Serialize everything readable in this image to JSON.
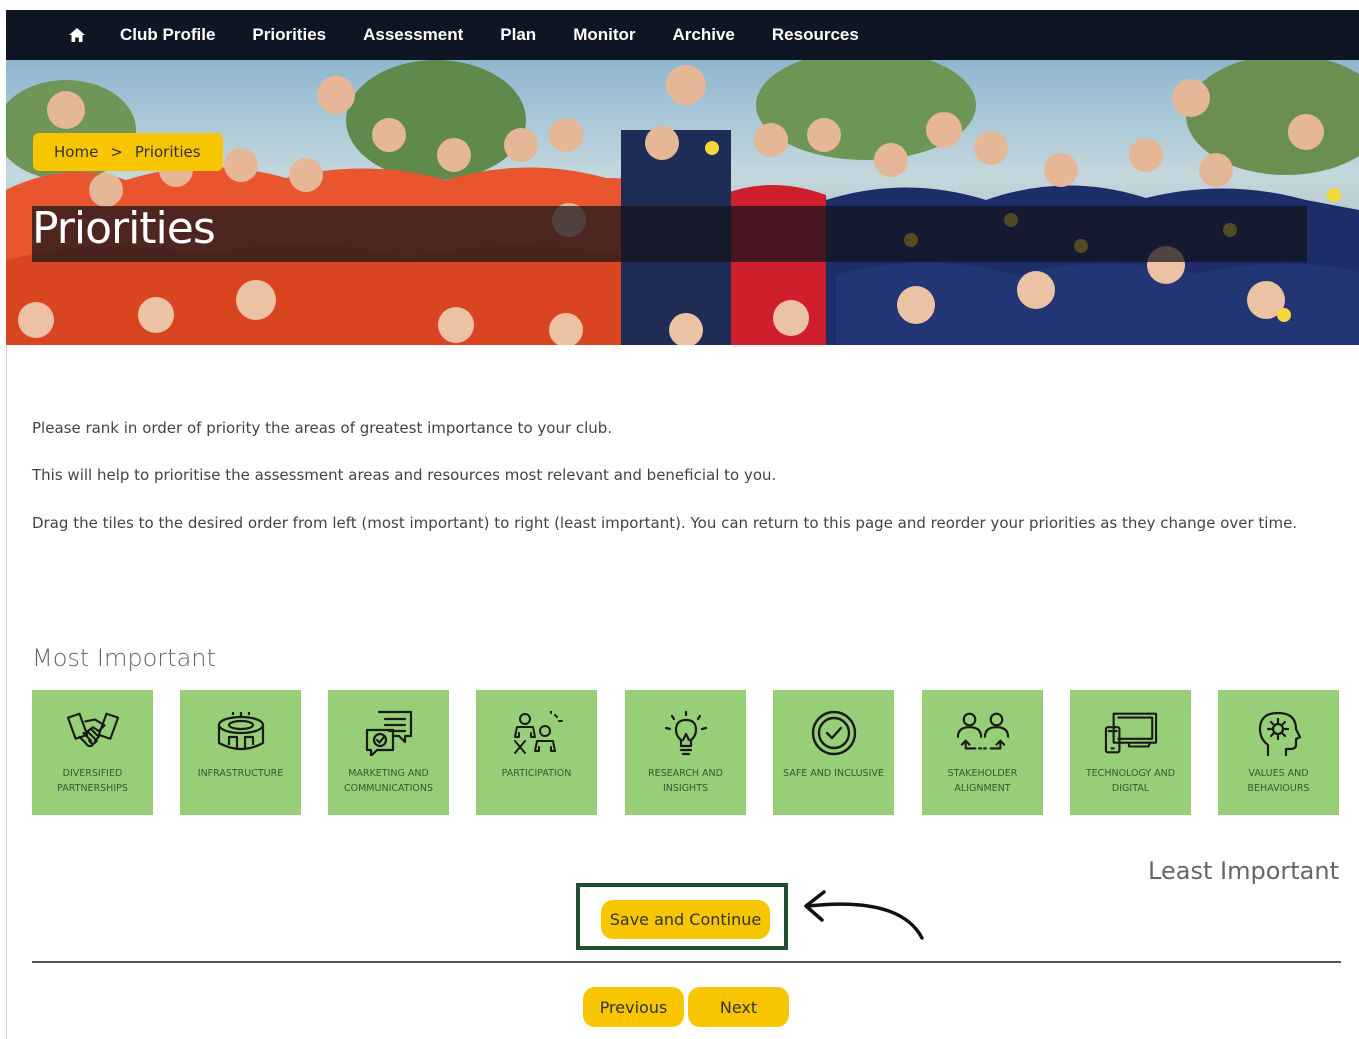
{
  "nav": {
    "home_icon": "home-icon",
    "items": [
      "Club Profile",
      "Priorities",
      "Assessment",
      "Plan",
      "Monitor",
      "Archive",
      "Resources"
    ]
  },
  "breadcrumb": {
    "home": "Home",
    "separator": ">",
    "current": "Priorities"
  },
  "hero": {
    "title": "Priorities"
  },
  "intro": {
    "line1": "Please rank in order of priority the areas of greatest importance to your club.",
    "line2": "This will help to prioritise the assessment areas and resources most relevant and beneficial to you.",
    "line3": "Drag the tiles to the desired order from left (most important) to right (least important). You can return to this page and reorder your priorities as they change over time."
  },
  "ranking": {
    "most_label": "Most Important",
    "least_label": "Least Important",
    "tiles": [
      {
        "label": "DIVERSIFIED PARTNERSHIPS",
        "icon": "handshake-icon"
      },
      {
        "label": "INFRASTRUCTURE",
        "icon": "stadium-icon"
      },
      {
        "label": "MARKETING AND COMMUNICATIONS",
        "icon": "chat-check-icon"
      },
      {
        "label": "PARTICIPATION",
        "icon": "people-group-icon"
      },
      {
        "label": "RESEARCH AND INSIGHTS",
        "icon": "lightbulb-icon"
      },
      {
        "label": "SAFE AND INCLUSIVE",
        "icon": "check-circle-icon"
      },
      {
        "label": "STAKEHOLDER ALIGNMENT",
        "icon": "people-exchange-icon"
      },
      {
        "label": "TECHNOLOGY AND DIGITAL",
        "icon": "devices-icon"
      },
      {
        "label": "VALUES AND BEHAVIOURS",
        "icon": "head-gear-icon"
      }
    ]
  },
  "actions": {
    "save": "Save and Continue",
    "previous": "Previous",
    "next": "Next"
  },
  "colors": {
    "nav_bg": "#0e1623",
    "accent": "#f7c600",
    "tile": "#96cf78",
    "highlight": "#1f4e32"
  }
}
